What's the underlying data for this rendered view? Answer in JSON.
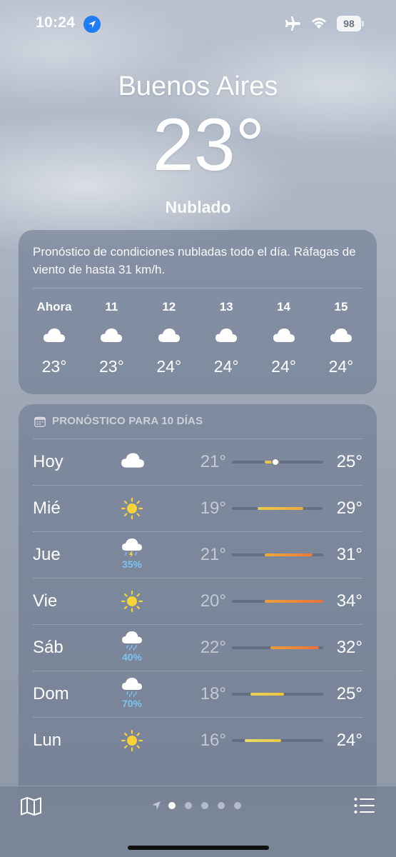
{
  "status_bar": {
    "time": "10:24",
    "battery": "98"
  },
  "header": {
    "city": "Buenos Aires",
    "temperature": "23°",
    "condition": "Nublado"
  },
  "hourly": {
    "summary": "Pronóstico de condiciones nubladas todo el día. Ráfagas de viento de hasta 31 km/h.",
    "hours": [
      {
        "label": "Ahora",
        "icon": "cloud-icon",
        "temp": "23°"
      },
      {
        "label": "11",
        "icon": "cloud-icon",
        "temp": "23°"
      },
      {
        "label": "12",
        "icon": "cloud-icon",
        "temp": "24°"
      },
      {
        "label": "13",
        "icon": "cloud-icon",
        "temp": "24°"
      },
      {
        "label": "14",
        "icon": "cloud-icon",
        "temp": "24°"
      },
      {
        "label": "15",
        "icon": "cloud-icon",
        "temp": "24°"
      }
    ]
  },
  "daily": {
    "title": "PRONÓSTICO PARA 10 DÍAS",
    "days": [
      {
        "name": "Hoy",
        "icon": "cloud-icon",
        "precip": "",
        "low": "21°",
        "high": "25°",
        "range_start": 0.36,
        "range_end": 0.52,
        "colors": [
          "#e9c94a",
          "#f0b23a"
        ],
        "now": 0.48
      },
      {
        "name": "Mié",
        "icon": "sun-icon",
        "precip": "",
        "low": "19°",
        "high": "29°",
        "range_start": 0.28,
        "range_end": 0.78,
        "colors": [
          "#e9c94a",
          "#f0a93a"
        ]
      },
      {
        "name": "Jue",
        "icon": "thunderstorm-icon",
        "precip": "35%",
        "low": "21°",
        "high": "31°",
        "range_start": 0.36,
        "range_end": 0.88,
        "colors": [
          "#f0a93a",
          "#ec7a3a"
        ]
      },
      {
        "name": "Vie",
        "icon": "sun-icon",
        "precip": "",
        "low": "20°",
        "high": "34°",
        "range_start": 0.36,
        "range_end": 1.0,
        "colors": [
          "#f0a03a",
          "#e9723a"
        ]
      },
      {
        "name": "Sáb",
        "icon": "rain-icon",
        "precip": "40%",
        "low": "22°",
        "high": "32°",
        "range_start": 0.42,
        "range_end": 0.95,
        "colors": [
          "#f09b3a",
          "#e9743a"
        ]
      },
      {
        "name": "Dom",
        "icon": "rain-icon",
        "precip": "70%",
        "low": "18°",
        "high": "25°",
        "range_start": 0.2,
        "range_end": 0.57,
        "colors": [
          "#e9d45a",
          "#efc03e"
        ]
      },
      {
        "name": "Lun",
        "icon": "sun-icon",
        "precip": "",
        "low": "16°",
        "high": "24°",
        "range_start": 0.14,
        "range_end": 0.54,
        "colors": [
          "#e9dc6a",
          "#e9c94a"
        ]
      }
    ]
  }
}
